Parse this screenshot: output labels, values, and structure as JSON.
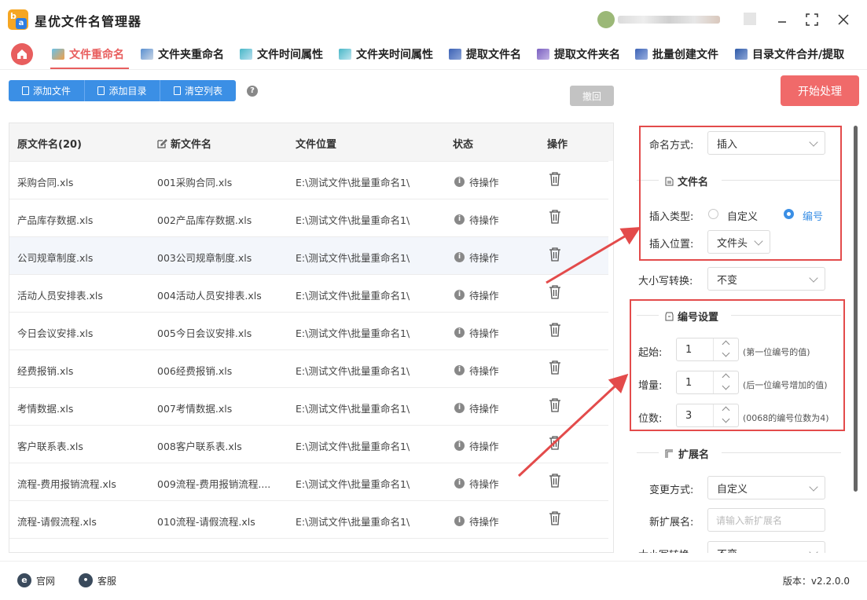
{
  "app": {
    "title": "星优文件名管理器",
    "logo_letters": {
      "b": "b",
      "a": "a"
    }
  },
  "nav": {
    "tabs": [
      {
        "label": "文件重命名",
        "active": true
      },
      {
        "label": "文件夹重命名"
      },
      {
        "label": "文件时间属性"
      },
      {
        "label": "文件夹时间属性"
      },
      {
        "label": "提取文件名"
      },
      {
        "label": "提取文件夹名"
      },
      {
        "label": "批量创建文件"
      },
      {
        "label": "目录文件合并/提取"
      }
    ]
  },
  "toolbar": {
    "add_file": "添加文件",
    "add_dir": "添加目录",
    "clear_list": "清空列表",
    "help": "?",
    "undo": "撤回",
    "start": "开始处理"
  },
  "table": {
    "headers": {
      "original": "原文件名(20)",
      "new_name": "新文件名",
      "location": "文件位置",
      "status": "状态",
      "action": "操作"
    },
    "rows": [
      {
        "original": "采购合同.xls",
        "new_name": "001采购合同.xls",
        "location": "E:\\测试文件\\批量重命名1\\",
        "status": "待操作"
      },
      {
        "original": "产品库存数据.xls",
        "new_name": "002产品库存数据.xls",
        "location": "E:\\测试文件\\批量重命名1\\",
        "status": "待操作"
      },
      {
        "original": "公司规章制度.xls",
        "new_name": "003公司规章制度.xls",
        "location": "E:\\测试文件\\批量重命名1\\",
        "status": "待操作"
      },
      {
        "original": "活动人员安排表.xls",
        "new_name": "004活动人员安排表.xls",
        "location": "E:\\测试文件\\批量重命名1\\",
        "status": "待操作"
      },
      {
        "original": "今日会议安排.xls",
        "new_name": "005今日会议安排.xls",
        "location": "E:\\测试文件\\批量重命名1\\",
        "status": "待操作"
      },
      {
        "original": "经费报销.xls",
        "new_name": "006经费报销.xls",
        "location": "E:\\测试文件\\批量重命名1\\",
        "status": "待操作"
      },
      {
        "original": "考情数据.xls",
        "new_name": "007考情数据.xls",
        "location": "E:\\测试文件\\批量重命名1\\",
        "status": "待操作"
      },
      {
        "original": "客户联系表.xls",
        "new_name": "008客户联系表.xls",
        "location": "E:\\测试文件\\批量重命名1\\",
        "status": "待操作"
      },
      {
        "original": "流程-费用报销流程.xls",
        "new_name": "009流程-费用报销流程....",
        "location": "E:\\测试文件\\批量重命名1\\",
        "status": "待操作"
      },
      {
        "original": "流程-请假流程.xls",
        "new_name": "010流程-请假流程.xls",
        "location": "E:\\测试文件\\批量重命名1\\",
        "status": "待操作"
      }
    ]
  },
  "panel": {
    "naming_mode_label": "命名方式:",
    "naming_mode_value": "插入",
    "filename_section": "文件名",
    "insert_type_label": "插入类型:",
    "insert_type_custom": "自定义",
    "insert_type_number": "编号",
    "insert_pos_label": "插入位置:",
    "insert_pos_value": "文件头",
    "case_label": "大小写转换:",
    "case_value": "不变",
    "numbering_section": "编号设置",
    "start_label": "起始:",
    "start_value": "1",
    "start_hint": "(第一位编号的值)",
    "step_label": "增量:",
    "step_value": "1",
    "step_hint": "(后一位编号增加的值)",
    "digits_label": "位数:",
    "digits_value": "3",
    "digits_hint": "(0068的编号位数为4)",
    "ext_section": "扩展名",
    "change_mode_label": "变更方式:",
    "change_mode_value": "自定义",
    "new_ext_label": "新扩展名:",
    "new_ext_placeholder": "请输入新扩展名",
    "ext_case_label": "大小写转换:",
    "ext_case_value": "不变"
  },
  "footer": {
    "website": "官网",
    "support": "客服",
    "version": "版本：v2.2.0.0"
  },
  "colors": {
    "accent_red": "#e85e5e",
    "button_blue": "#3b8fe5",
    "highlight_box": "#e34b4b"
  }
}
